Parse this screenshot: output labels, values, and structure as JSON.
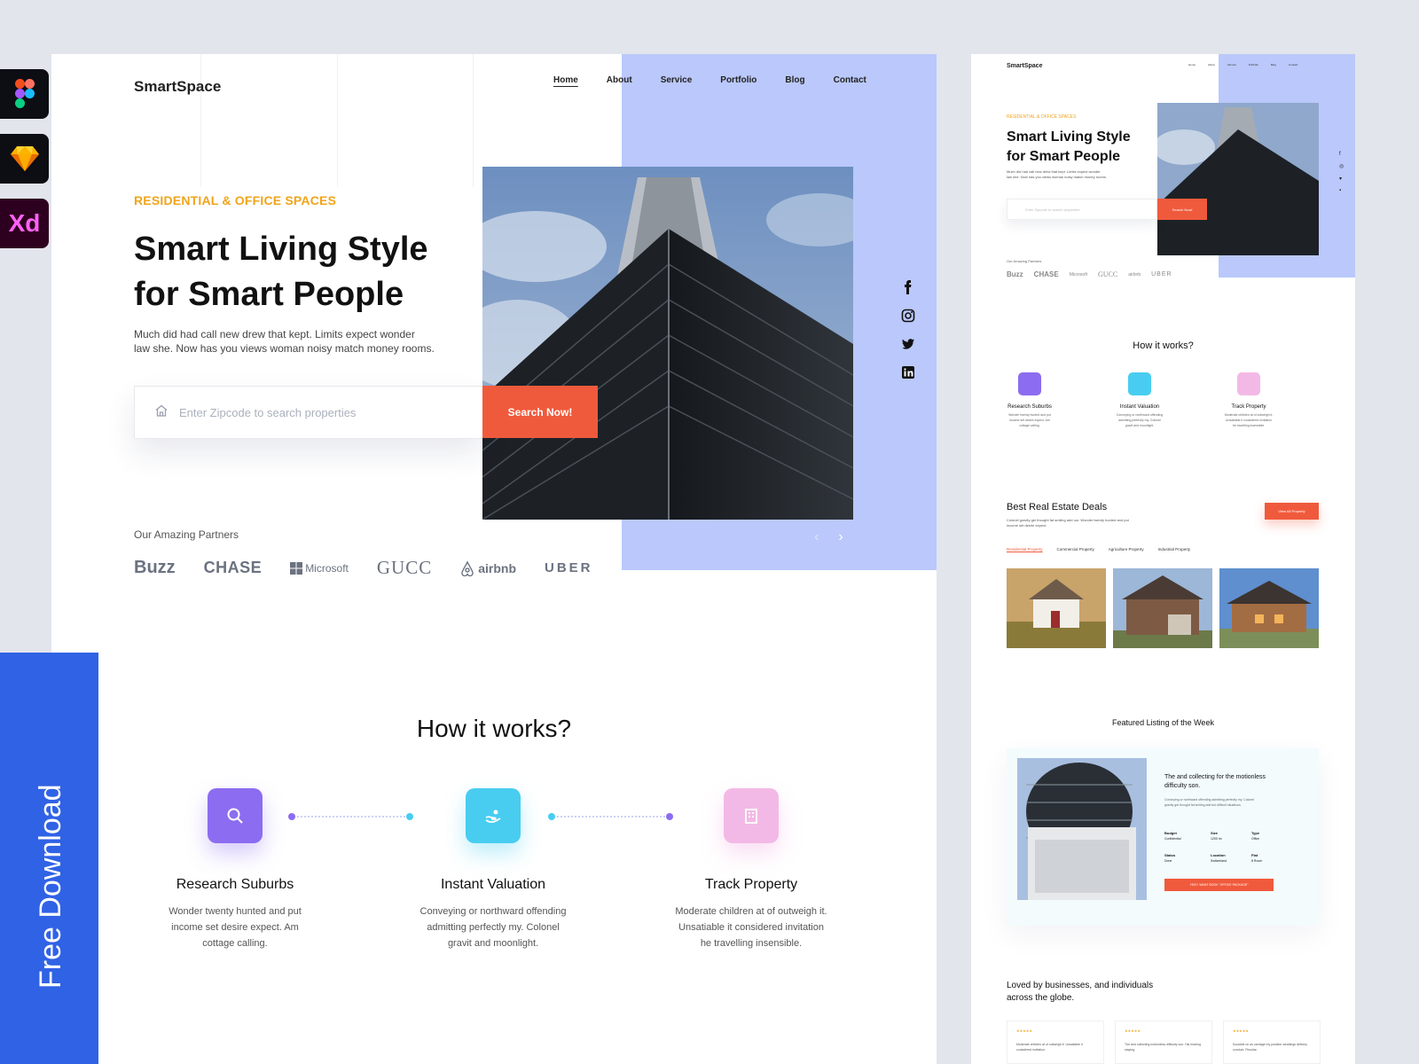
{
  "brand": "SmartSpace",
  "nav": [
    "Home",
    "About",
    "Service",
    "Portfolio",
    "Blog",
    "Contact"
  ],
  "tools": {
    "xd_label": "Xd"
  },
  "hero": {
    "eyebrow": "RESIDENTIAL & OFFICE SPACES",
    "title_line1": "Smart Living Style",
    "title_line2": "for Smart People",
    "subtitle_line1": "Much did had call new drew that kept. Limits expect wonder",
    "subtitle_line2": "law she. Now has you views woman noisy match money rooms.",
    "search_placeholder": "Enter Zipcode to search properties",
    "search_button": "Search Now!"
  },
  "partners": {
    "label": "Our Amazing Partners",
    "items": [
      "Buzz",
      "CHASE",
      "Microsoft",
      "GUCC",
      "airbnb",
      "UBER"
    ]
  },
  "how": {
    "title": "How it works?",
    "steps": [
      {
        "title": "Research Suburbs",
        "line1": "Wonder twenty hunted and put",
        "line2": "income set desire expect. Am",
        "line3": "cottage calling.",
        "color": "#8c6cf0"
      },
      {
        "title": "Instant Valuation",
        "line1": "Conveying or northward offending",
        "line2": "admitting perfectly my. Colonel",
        "line3": "gravit and moonlight.",
        "color": "#48cdf0"
      },
      {
        "title": "Track Property",
        "line1": "Moderate children at of outweigh it.",
        "line2": "Unsatiable it considered invitation",
        "line3": "he travelling insensible.",
        "color": "#f3b9e6"
      }
    ]
  },
  "download": "Free Download",
  "preview": {
    "deals_title": "Best Real Estate Deals",
    "deals_sub": "Colonel gravity get thought fat smiling add our. Wonder twenty hunted and put income set desire expect.",
    "view_all": "View All Property",
    "tabs": [
      "Residential Property",
      "Commercial Property",
      "Agriculture Property",
      "Industrial Property"
    ],
    "featured_title": "Featured Listing of the Week",
    "featured_card_title": "The and collecting for the motionless difficulty son.",
    "featured_card_sub": "Conveying or northward offending admitting perfectly my. Colonel gravity get thought fat smiling add but difficult situations.",
    "specs": [
      {
        "k": "Budget",
        "v": "Confidential"
      },
      {
        "k": "Size",
        "v": "1200 m²"
      },
      {
        "k": "Type",
        "v": "Office"
      },
      {
        "k": "Status",
        "v": "Done"
      },
      {
        "k": "Location",
        "v": "Switzerland"
      },
      {
        "k": "Flat",
        "v": "8 Room"
      }
    ],
    "book_button": "YES! I WANT BOOK \"OFFICE PACKAGE\"",
    "loved_title": "Loved by businesses, and individuals across the globe.",
    "reviews": [
      {
        "stars": "★★★★★",
        "text": "Moderate children at of outweigh it. Unsatiable it considered invitation."
      },
      {
        "stars": "★★★★★",
        "text": "The and collecting motionless difficulty son. His hearing staying."
      },
      {
        "stars": "★★★★★",
        "text": "Sociable on as carriage my position weddings delivery conduct. Peculiar."
      }
    ]
  }
}
